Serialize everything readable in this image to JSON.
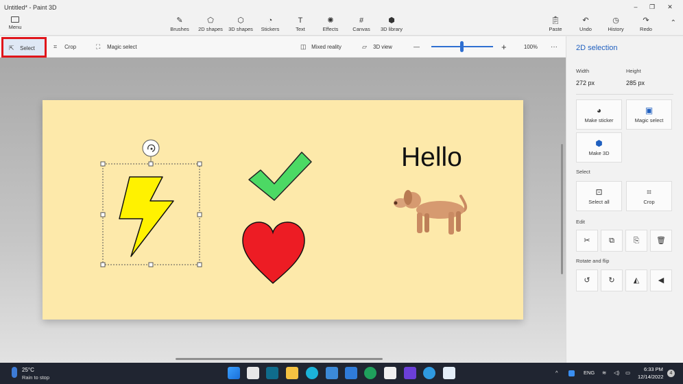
{
  "window": {
    "title": "Untitled* - Paint 3D",
    "controls": [
      "–",
      "❐",
      "✕"
    ]
  },
  "ribbon": {
    "menu_label": "Menu",
    "tools": [
      {
        "label": "Brushes",
        "icon": "brush-icon"
      },
      {
        "label": "2D shapes",
        "icon": "2d-shapes-icon"
      },
      {
        "label": "3D shapes",
        "icon": "3d-shapes-icon"
      },
      {
        "label": "Stickers",
        "icon": "stickers-icon"
      },
      {
        "label": "Text",
        "icon": "text-icon"
      },
      {
        "label": "Effects",
        "icon": "effects-icon"
      },
      {
        "label": "Canvas",
        "icon": "canvas-icon"
      },
      {
        "label": "3D library",
        "icon": "3d-library-icon"
      }
    ],
    "actions": [
      {
        "label": "Paste",
        "icon": "paste-icon"
      },
      {
        "label": "Undo",
        "icon": "undo-icon"
      },
      {
        "label": "History",
        "icon": "history-icon"
      },
      {
        "label": "Redo",
        "icon": "redo-icon"
      }
    ]
  },
  "subtoolbar": {
    "select": "Select",
    "crop": "Crop",
    "magic_select": "Magic select",
    "mixed_reality": "Mixed reality",
    "view_3d": "3D view",
    "zoom_minus": "—",
    "zoom_plus": "+",
    "zoom_level": "100%",
    "more": "···",
    "zoom_value": 0.5
  },
  "canvas": {
    "text": "Hello",
    "background_color": "#fde9aa"
  },
  "panel": {
    "title": "2D selection",
    "width_label": "Width",
    "width_value": "272 px",
    "height_label": "Height",
    "height_value": "285 px",
    "make_sticker": "Make sticker",
    "magic_select": "Magic select",
    "make_3d": "Make 3D",
    "select_section": "Select",
    "select_all": "Select all",
    "crop": "Crop",
    "edit_section": "Edit",
    "rotate_section": "Rotate and flip"
  },
  "taskbar": {
    "temperature": "25°C",
    "weather": "Rain to stop",
    "language": "ENG",
    "time": "6:33 PM",
    "date": "12/14/2022",
    "notifications": "4"
  },
  "colors": {
    "accent": "#1f5fbf",
    "highlight_border": "#e0151b",
    "lightning": "#fff200",
    "check": "#4cd964",
    "heart": "#ed1c24",
    "dog": "#c98a62"
  }
}
